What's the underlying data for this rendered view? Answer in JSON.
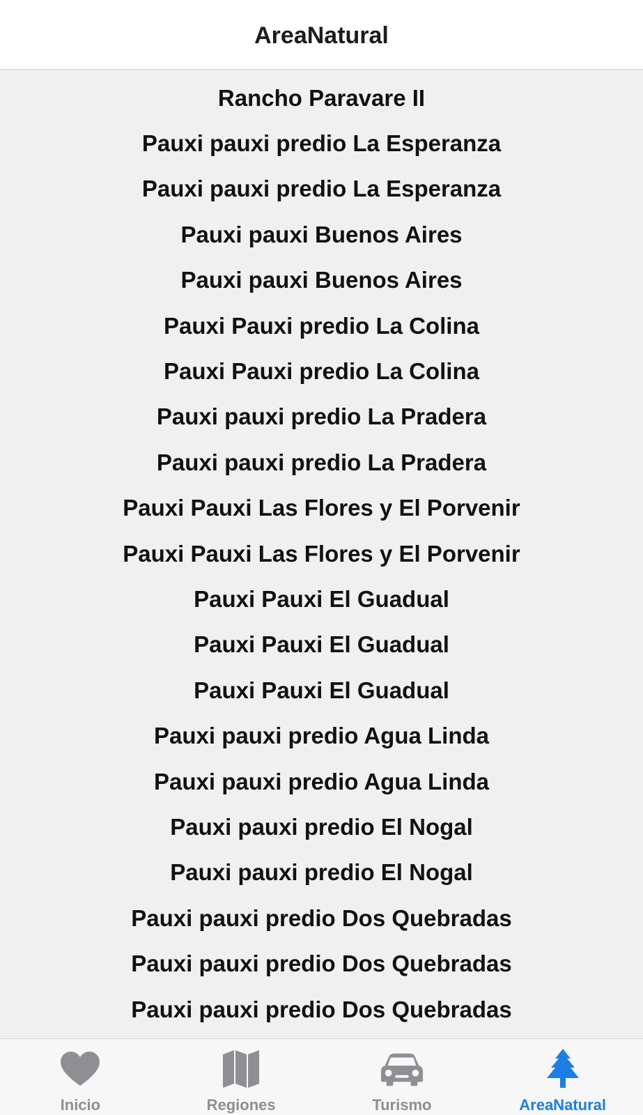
{
  "header": {
    "title": "AreaNatural"
  },
  "list": {
    "items": [
      "Rancho Paravare II",
      "Pauxi pauxi predio La Esperanza",
      "Pauxi pauxi predio La Esperanza",
      "Pauxi pauxi Buenos Aires",
      "Pauxi pauxi Buenos Aires",
      "Pauxi Pauxi predio La Colina",
      "Pauxi Pauxi predio La Colina",
      "Pauxi pauxi predio La Pradera",
      "Pauxi pauxi predio La Pradera",
      "Pauxi Pauxi Las Flores y El Porvenir",
      "Pauxi Pauxi Las Flores y El Porvenir",
      "Pauxi Pauxi El Guadual",
      "Pauxi Pauxi El Guadual",
      "Pauxi Pauxi El Guadual",
      "Pauxi pauxi predio Agua Linda",
      "Pauxi pauxi predio Agua Linda",
      "Pauxi pauxi predio El Nogal",
      "Pauxi pauxi predio El Nogal",
      "Pauxi pauxi predio Dos Quebradas",
      "Pauxi pauxi predio Dos Quebradas",
      "Pauxi pauxi predio Dos Quebradas"
    ]
  },
  "tabbar": {
    "tabs": [
      {
        "label": "Inicio",
        "icon": "heart-icon",
        "active": false
      },
      {
        "label": "Regiones",
        "icon": "map-icon",
        "active": false
      },
      {
        "label": "Turismo",
        "icon": "car-icon",
        "active": false
      },
      {
        "label": "AreaNatural",
        "icon": "tree-icon",
        "active": true
      }
    ]
  },
  "colors": {
    "accent": "#1a7ee6",
    "inactive": "#8e8e93",
    "background": "#f0f0f0"
  }
}
